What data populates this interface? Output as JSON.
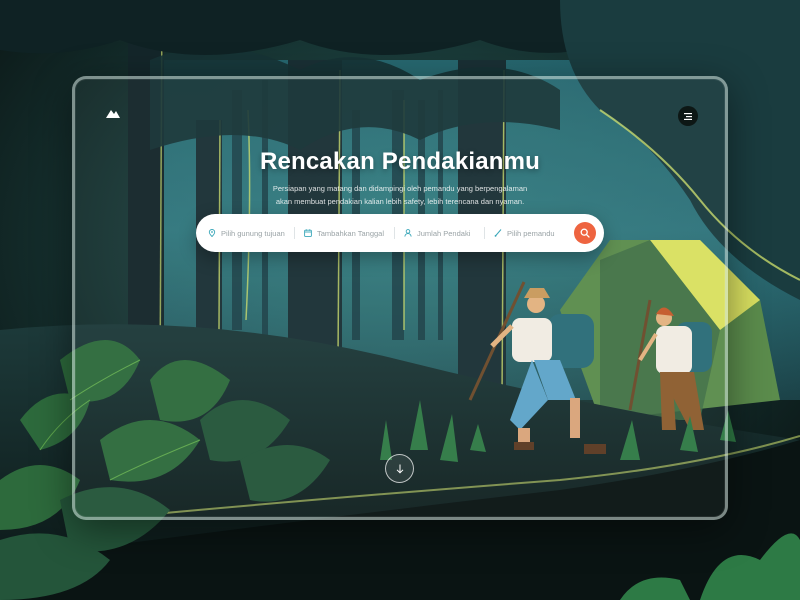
{
  "hero": {
    "title": "Rencakan Pendakianmu",
    "subtitle": "Persiapan yang matang dan didampingi oleh pemandu yang berpengalaman akan membuat pendakian kalian lebih safety, lebih terencana dan nyaman."
  },
  "search": {
    "fields": [
      {
        "label": "Pilih gunung tujuan",
        "icon": "location-pin-icon"
      },
      {
        "label": "Tambahkan Tanggal",
        "icon": "calendar-icon"
      },
      {
        "label": "Jumlah Pendaki",
        "icon": "user-icon"
      },
      {
        "label": "Pilih pemandu",
        "icon": "hiking-pole-icon"
      }
    ],
    "submit_icon": "search-icon"
  },
  "colors": {
    "accent": "#ee6440",
    "field_icon": "#3aa7b9",
    "background": "#0c1a18"
  }
}
